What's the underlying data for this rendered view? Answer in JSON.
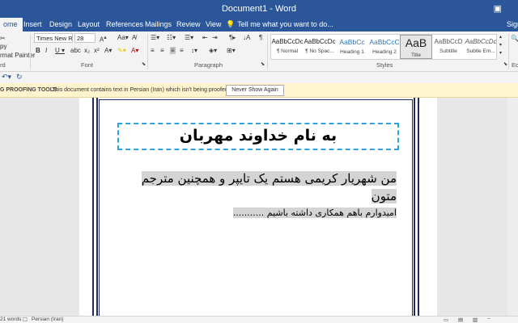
{
  "app": {
    "title": "Document1 - Word"
  },
  "tabs": [
    {
      "label": "ome",
      "active": true
    },
    {
      "label": "Insert"
    },
    {
      "label": "Design"
    },
    {
      "label": "Layout"
    },
    {
      "label": "References"
    },
    {
      "label": "Mailings"
    },
    {
      "label": "Review"
    },
    {
      "label": "View"
    }
  ],
  "tell_me": {
    "placeholder": "Tell me what you want to do..."
  },
  "sign_in": "Sign",
  "ribbon": {
    "clipboard": {
      "format_painter": "rmat Painter",
      "copy": "py",
      "label": "rd"
    },
    "font": {
      "font_name": "Times New Ro",
      "font_size": "28",
      "label": "Font"
    },
    "paragraph": {
      "label": "Paragraph"
    },
    "styles": {
      "label": "Styles",
      "items": [
        {
          "sample": "AaBbCcDc",
          "name": "¶ Normal"
        },
        {
          "sample": "AaBbCcDc",
          "name": "¶ No Spac..."
        },
        {
          "sample": "AaBbCc",
          "name": "Heading 1"
        },
        {
          "sample": "AaBbCcC",
          "name": "Heading 2"
        },
        {
          "sample": "AaB",
          "name": "Title"
        },
        {
          "sample": "AaBbCcD",
          "name": "Subtitle"
        },
        {
          "sample": "AaBbCcDc",
          "name": "Subtle Em..."
        }
      ]
    },
    "editing": {
      "label": "Ed"
    }
  },
  "infobar": {
    "title": "G PROOFING TOOLS",
    "message": "This document contains text in Persian (Iran) which isn't being proofed.",
    "button": "Never Show Again"
  },
  "document": {
    "heading": "به نام خداوند مهربان",
    "paragraph1": "من شهریار کریمی هستم یک تایپر و همچنین مترجم متون",
    "paragraph2": "امیدوارم باهم همکاری داشته باشیم ..........."
  },
  "status": {
    "words": "21 words",
    "language": "Persian (Iran)"
  },
  "colors": {
    "brand": "#2b579a",
    "infobar": "#fff4ce",
    "heading_border": "#2ba3df",
    "page_border": "#1f2b5c"
  }
}
